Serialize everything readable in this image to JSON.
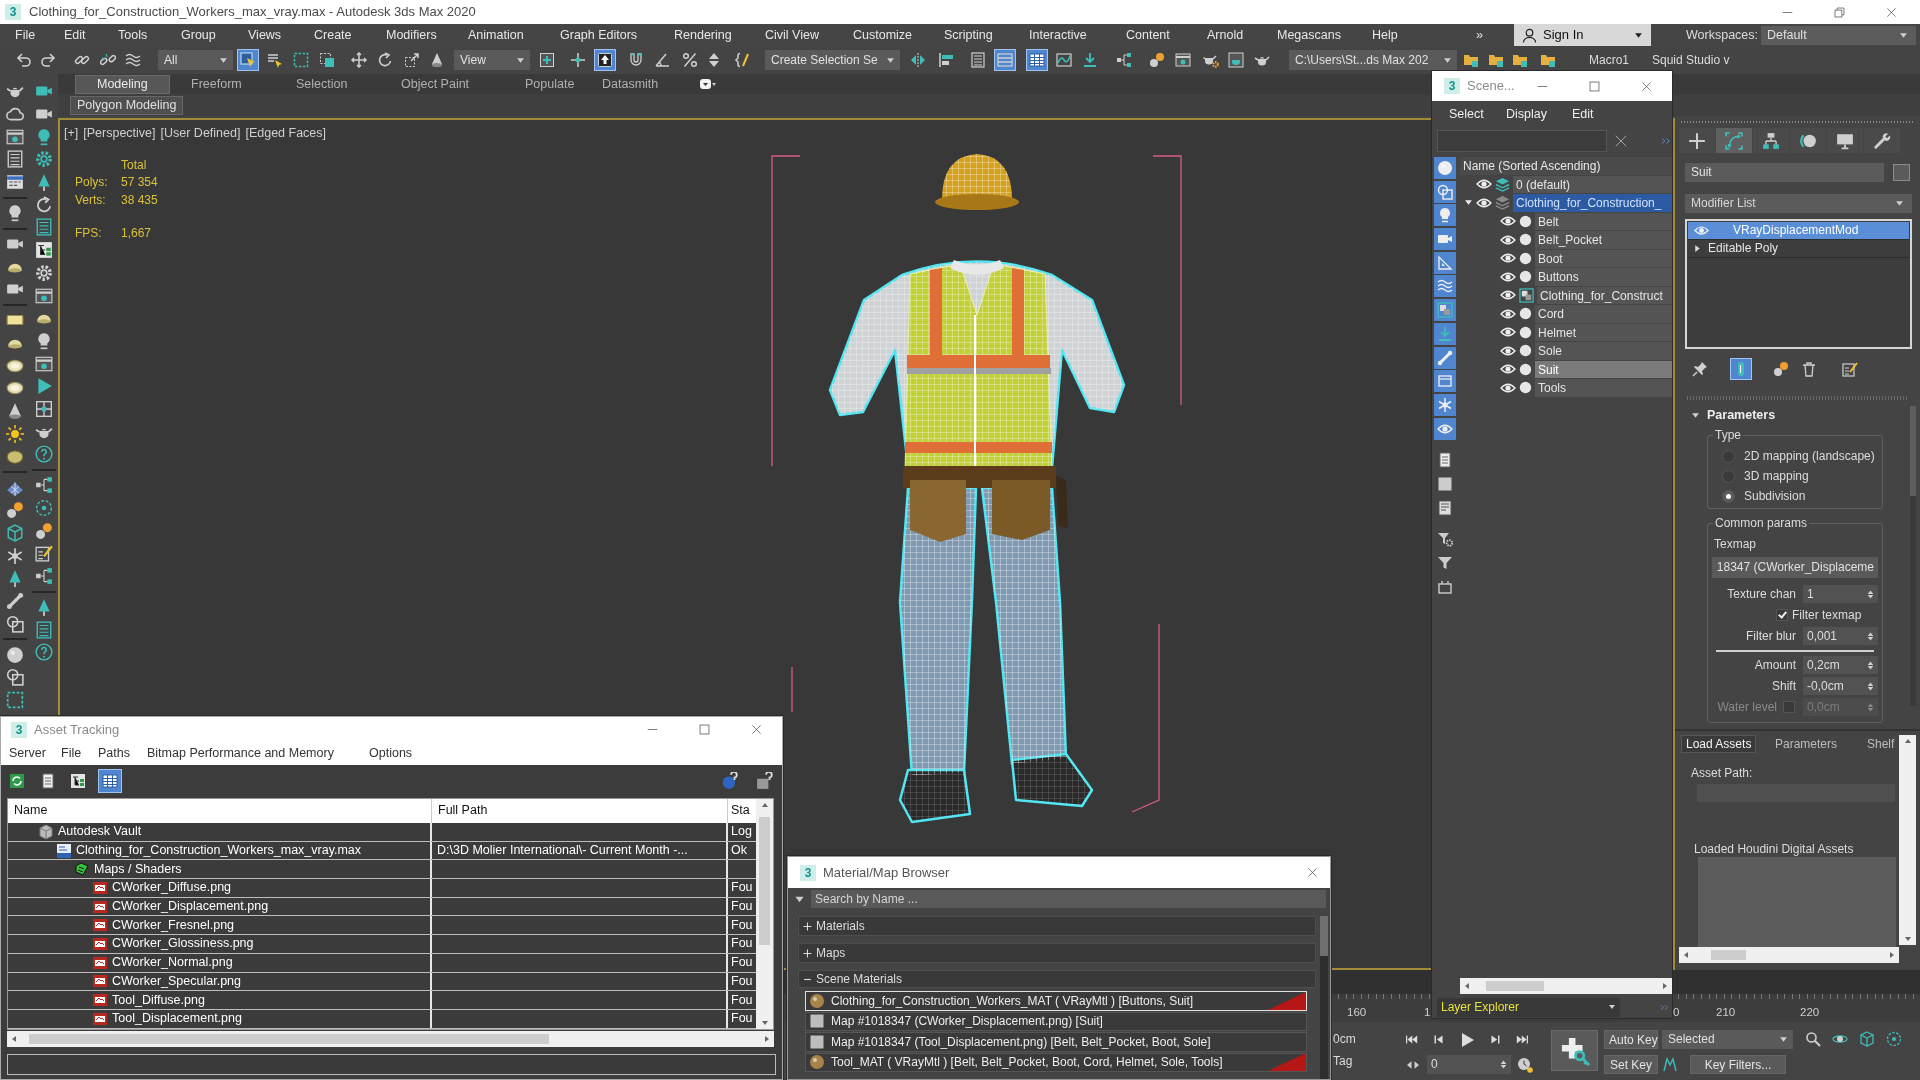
{
  "window": {
    "logo": "3",
    "title": "Clothing_for_Construction_Workers_max_vray.max - Autodesk 3ds Max 2020"
  },
  "menu_bar": {
    "items": [
      "File",
      "Edit",
      "Tools",
      "Group",
      "Views",
      "Create",
      "Modifiers",
      "Animation",
      "Graph Editors",
      "Rendering",
      "Civil View",
      "Customize",
      "Scripting",
      "Interactive",
      "Content",
      "Arnold",
      "Megascans",
      "Help"
    ],
    "overflow": "»",
    "sign_in": "Sign In",
    "workspaces_label": "Workspaces:",
    "workspace": "Default"
  },
  "main_toolbar": {
    "items": [
      {
        "kind": "undo",
        "on": false
      },
      {
        "kind": "redo",
        "on": false
      },
      {
        "kind": "link",
        "on": false
      },
      {
        "kind": "unlink",
        "on": false
      },
      {
        "kind": "wave",
        "on": false
      },
      {
        "kind": "dropdown",
        "value": "All"
      },
      {
        "kind": "cursor-box",
        "on": true
      },
      {
        "kind": "list-cursor",
        "on": false
      },
      {
        "kind": "dashed-square",
        "on": false
      },
      {
        "kind": "dotted-square",
        "on": false
      },
      {
        "kind": "move",
        "on": false
      },
      {
        "kind": "rotate",
        "on": false
      },
      {
        "kind": "scale",
        "on": false
      },
      {
        "kind": "cone",
        "on": false
      },
      {
        "kind": "dropdown",
        "value": "View"
      },
      {
        "kind": "plus-box",
        "on": false
      },
      {
        "kind": "crosshair",
        "on": false
      },
      {
        "kind": "arrow-box",
        "on": true
      },
      {
        "kind": "magnet",
        "on": false
      },
      {
        "kind": "angle",
        "on": false
      },
      {
        "kind": "percent",
        "on": false
      },
      {
        "kind": "updown",
        "on": false
      },
      {
        "kind": "brace",
        "on": false
      },
      {
        "kind": "dropdown",
        "value": "Create Selection Se"
      },
      {
        "kind": "mirror",
        "on": false
      },
      {
        "kind": "align",
        "on": false
      },
      {
        "kind": "list",
        "on": false
      },
      {
        "kind": "stripes",
        "on": true
      },
      {
        "kind": "table",
        "on": true
      },
      {
        "kind": "curve",
        "on": false
      },
      {
        "kind": "download",
        "on": false
      },
      {
        "kind": "nodes",
        "on": false
      },
      {
        "kind": "spheres",
        "on": false
      },
      {
        "kind": "window",
        "on": false
      },
      {
        "kind": "teapot-gear",
        "on": false
      },
      {
        "kind": "teapot-window",
        "on": false
      },
      {
        "kind": "teapot",
        "on": false
      },
      {
        "kind": "dropdown",
        "value": "C:\\Users\\St...ds Max 202"
      },
      {
        "kind": "folder",
        "on": false
      },
      {
        "kind": "folder",
        "on": false
      },
      {
        "kind": "folder",
        "on": false
      },
      {
        "kind": "folder",
        "on": false
      },
      {
        "kind": "label",
        "value": "Macro1"
      },
      {
        "kind": "label",
        "value": "Squid Studio v"
      }
    ]
  },
  "ribbon": {
    "tabs": [
      {
        "label": "Modeling",
        "selected": true
      },
      {
        "label": "Freeform",
        "selected": false
      },
      {
        "label": "Selection",
        "selected": false
      },
      {
        "label": "Object Paint",
        "selected": false
      },
      {
        "label": "Populate",
        "selected": false
      },
      {
        "label": "Datasmith",
        "selected": false
      }
    ],
    "panel_button": "Polygon Modeling"
  },
  "viewport": {
    "labels": [
      "[+]",
      "[Perspective]",
      "[User Defined]",
      "[Edged Faces]"
    ],
    "stats_header": "Total",
    "stats": [
      {
        "label": "Polys:",
        "value": "57 354",
        "kind": "count"
      },
      {
        "label": "Verts:",
        "value": "38 435",
        "kind": "count"
      },
      {
        "label": "FPS:",
        "value": "1,667",
        "kind": "rate"
      }
    ]
  },
  "scene_explorer": {
    "logo": "3",
    "title": "Scene...",
    "menu": [
      "Select",
      "Display",
      "Edit"
    ],
    "filters": [
      {
        "kind": "sphere",
        "on": true
      },
      {
        "kind": "shapes",
        "on": true
      },
      {
        "kind": "bulb",
        "on": true
      },
      {
        "kind": "camera",
        "on": true
      },
      {
        "kind": "ruler",
        "on": true
      },
      {
        "kind": "wave",
        "on": true
      },
      {
        "kind": "group",
        "on": true
      },
      {
        "kind": "download",
        "on": true
      },
      {
        "kind": "bone",
        "on": true
      },
      {
        "kind": "box",
        "on": true
      },
      {
        "kind": "snowflake",
        "on": true
      },
      {
        "kind": "eye",
        "on": true
      },
      {
        "kind": "doc",
        "on": false
      },
      {
        "kind": "square",
        "on": false
      },
      {
        "kind": "doc-lines",
        "on": false
      },
      {
        "kind": "funnel-gear",
        "on": false
      },
      {
        "kind": "funnel",
        "on": false
      },
      {
        "kind": "plug",
        "on": false
      }
    ],
    "column": "Name (Sorted Ascending)",
    "tree": [
      {
        "name": "0 (default)",
        "kind": "layer",
        "current": true,
        "selected": false
      },
      {
        "name": "Clothing_for_Construction_",
        "kind": "layer",
        "current": false,
        "selected": true,
        "expanded": true,
        "children": [
          {
            "name": "Belt",
            "kind": "object",
            "selected": false
          },
          {
            "name": "Belt_Pocket",
            "kind": "object",
            "selected": false
          },
          {
            "name": "Boot",
            "kind": "object",
            "selected": false
          },
          {
            "name": "Buttons",
            "kind": "object",
            "selected": false
          },
          {
            "name": "Clothing_for_Construct",
            "kind": "group",
            "selected": false
          },
          {
            "name": "Cord",
            "kind": "object",
            "selected": false
          },
          {
            "name": "Helmet",
            "kind": "object",
            "selected": false
          },
          {
            "name": "Sole",
            "kind": "object",
            "selected": false
          },
          {
            "name": "Suit",
            "kind": "object",
            "selected": true
          },
          {
            "name": "Tools",
            "kind": "object",
            "selected": false
          }
        ]
      }
    ],
    "footer": "Layer Explorer"
  },
  "command_panel": {
    "tabs": [
      {
        "kind": "plus",
        "selected": false
      },
      {
        "kind": "curve-frame",
        "selected": true
      },
      {
        "kind": "hierarchy",
        "selected": false
      },
      {
        "kind": "disc",
        "selected": false
      },
      {
        "kind": "monitor",
        "selected": false
      },
      {
        "kind": "wrench",
        "selected": false
      }
    ],
    "object_name": "Suit",
    "modifier_list": "Modifier List",
    "stack": [
      {
        "name": "VRayDisplacementMod",
        "kind": "modifier",
        "selected": true
      },
      {
        "name": "Editable Poly",
        "kind": "base",
        "selected": false
      }
    ],
    "stack_tools": [
      {
        "kind": "pin",
        "on": false
      },
      {
        "kind": "tube",
        "on": true
      },
      {
        "kind": "spheres",
        "on": false
      },
      {
        "kind": "trash",
        "on": false
      },
      {
        "kind": "doc-pen",
        "on": false
      }
    ],
    "parameters": {
      "title": "Parameters",
      "expanded": true,
      "type_label": "Type",
      "type_options": [
        {
          "label": "2D mapping (landscape)",
          "selected": false
        },
        {
          "label": "3D mapping",
          "selected": false
        },
        {
          "label": "Subdivision",
          "selected": true
        }
      ],
      "common_label": "Common params",
      "texmap_label": "Texmap",
      "texmap": "18347 (CWorker_Displaceme",
      "texmap_fields": [
        {
          "kind": "spinner",
          "label": "Texture chan",
          "value": "1"
        },
        {
          "kind": "checkbox",
          "label": "Filter texmap",
          "checked": true
        },
        {
          "kind": "spinner",
          "label": "Filter blur",
          "value": "0,001"
        }
      ],
      "displacement_fields": [
        {
          "kind": "spinner",
          "label": "Amount",
          "value": "0,2cm"
        },
        {
          "kind": "spinner",
          "label": "Shift",
          "value": "-0,0cm"
        },
        {
          "kind": "checked_spinner",
          "label": "Water level",
          "checked": false,
          "value": "0,0cm",
          "disabled": true
        }
      ]
    }
  },
  "houdini_panel": {
    "tabs": [
      {
        "label": "Load Assets",
        "selected": true
      },
      {
        "label": "Parameters",
        "selected": false
      },
      {
        "label": "Shelf",
        "selected": false
      }
    ],
    "asset_path_label": "Asset Path:",
    "loaded_label": "Loaded Houdini Digital Assets"
  },
  "asset_tracking": {
    "logo": "3",
    "title": "Asset Tracking",
    "menu": [
      "Server",
      "File",
      "Paths",
      "Bitmap Performance and Memory",
      "Options"
    ],
    "tools": [
      {
        "kind": "refresh",
        "on": false
      },
      {
        "kind": "doc",
        "on": false
      },
      {
        "kind": "tree-view",
        "on": false
      },
      {
        "kind": "table",
        "on": true
      }
    ],
    "columns": [
      "Name",
      "Full Path",
      "Sta"
    ],
    "tree": [
      {
        "name": "Autodesk Vault",
        "kind": "vault",
        "status": "Log",
        "children": [
          {
            "name": "Clothing_for_Construction_Workers_max_vray.max",
            "kind": "max",
            "path": "D:\\3D Molier International\\- Current Month -...",
            "status": "Ok",
            "children": [
              {
                "name": "Maps / Shaders",
                "kind": "folder",
                "children": [
                  {
                    "name": "CWorker_Diffuse.png",
                    "kind": "png",
                    "status": "Fou"
                  },
                  {
                    "name": "CWorker_Displacement.png",
                    "kind": "png",
                    "status": "Fou"
                  },
                  {
                    "name": "CWorker_Fresnel.png",
                    "kind": "png",
                    "status": "Fou"
                  },
                  {
                    "name": "CWorker_Glossiness.png",
                    "kind": "png",
                    "status": "Fou"
                  },
                  {
                    "name": "CWorker_Normal.png",
                    "kind": "png",
                    "status": "Fou"
                  },
                  {
                    "name": "CWorker_Specular.png",
                    "kind": "png",
                    "status": "Fou"
                  },
                  {
                    "name": "Tool_Diffuse.png",
                    "kind": "png",
                    "status": "Fou"
                  },
                  {
                    "name": "Tool_Displacement.png",
                    "kind": "png",
                    "status": "Fou"
                  }
                ]
              }
            ]
          }
        ]
      }
    ]
  },
  "material_browser": {
    "logo": "3",
    "title": "Material/Map Browser",
    "search_placeholder": "Search by Name ...",
    "groups": [
      {
        "label": "Materials",
        "expanded": false
      },
      {
        "label": "Maps",
        "expanded": false
      },
      {
        "label": "Scene Materials",
        "expanded": true,
        "items": [
          {
            "label": "Clothing_for_Construction_Workers_MAT ( VRayMtl ) [Buttons, Suit]",
            "kind": "material",
            "selected": true
          },
          {
            "label": "Map #1018347 (CWorker_Displacement.png) [Suit]",
            "kind": "map",
            "selected": false
          },
          {
            "label": "Map #1018347 (Tool_Displacement.png) [Belt, Belt_Pocket, Boot, Sole]",
            "kind": "map",
            "selected": false
          },
          {
            "label": "Tool_MAT ( VRayMtl ) [Belt, Belt_Pocket, Boot, Cord, Helmet, Sole, Tools]",
            "kind": "material",
            "selected": false
          }
        ]
      }
    ]
  },
  "timeline": {
    "ticks": [
      "160",
      "1",
      "0",
      "210",
      "220"
    ]
  },
  "status_bar": {
    "z_value": "0cm",
    "time_tag": "Tag",
    "auto_key": "Auto Key",
    "set_key": "Set Key",
    "key_mode": "Selected",
    "frame": "0",
    "key_filters": "Key Filters..."
  }
}
